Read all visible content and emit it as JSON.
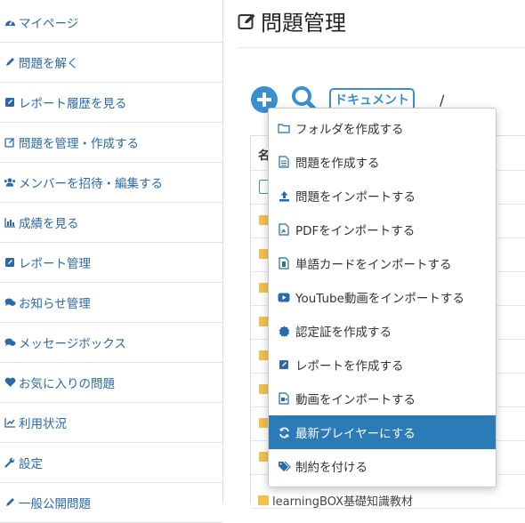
{
  "sidebar": {
    "items": [
      {
        "label": "マイページ",
        "icon": "dashboard-icon"
      },
      {
        "label": "問題を解く",
        "icon": "pencil-icon"
      },
      {
        "label": "レポート履歴を見る",
        "icon": "edit-square-icon"
      },
      {
        "label": "問題を管理・作成する",
        "icon": "edit-outline-icon"
      },
      {
        "label": "メンバーを招待・編集する",
        "icon": "users-icon"
      },
      {
        "label": "成績を見る",
        "icon": "bar-chart-icon"
      },
      {
        "label": "レポート管理",
        "icon": "edit-square-icon"
      },
      {
        "label": "お知らせ管理",
        "icon": "comments-icon"
      },
      {
        "label": "メッセージボックス",
        "icon": "comments-icon"
      },
      {
        "label": "お気に入りの問題",
        "icon": "heart-icon"
      },
      {
        "label": "利用状況",
        "icon": "line-chart-icon"
      },
      {
        "label": "設定",
        "icon": "wrench-icon"
      },
      {
        "label": "一般公開問題",
        "icon": "pencil-icon"
      }
    ]
  },
  "main": {
    "title": "問題管理",
    "toolbar": {
      "documents_label": "ドキュメント",
      "path_separator": "/"
    },
    "table": {
      "header": "名",
      "bottom_row_label": "learningBOX基礎知識教材"
    }
  },
  "dropdown": {
    "items": [
      {
        "label": "フォルダを作成する",
        "icon": "folder-outline-icon"
      },
      {
        "label": "問題を作成する",
        "icon": "file-icon"
      },
      {
        "label": "問題をインポートする",
        "icon": "upload-icon"
      },
      {
        "label": "PDFをインポートする",
        "icon": "pdf-icon"
      },
      {
        "label": "単語カードをインポートする",
        "icon": "card-icon"
      },
      {
        "label": "YouTube動画をインポートする",
        "icon": "youtube-icon"
      },
      {
        "label": "認定証を作成する",
        "icon": "certificate-icon"
      },
      {
        "label": "レポートを作成する",
        "icon": "edit-square-icon"
      },
      {
        "label": "動画をインポートする",
        "icon": "video-file-icon"
      },
      {
        "label": "最新プレイヤーにする",
        "icon": "refresh-icon",
        "active": true
      },
      {
        "label": "制約を付ける",
        "icon": "tags-icon"
      }
    ]
  },
  "colors": {
    "accent": "#2b7bb9",
    "link": "#2a6aa8",
    "folder": "#f5c04a"
  }
}
